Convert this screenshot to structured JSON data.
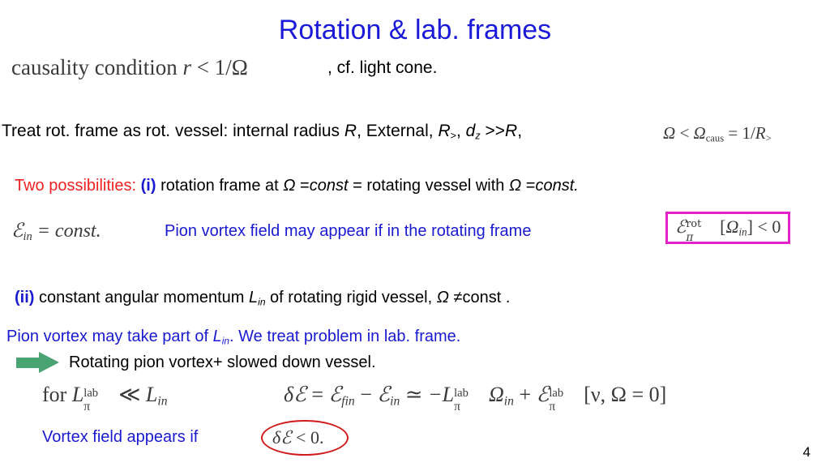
{
  "slide": {
    "title": "Rotation  & lab. frames",
    "page_number": "4",
    "colors": {
      "title_blue": "#1a1ad8",
      "accent_red": "#ee2222",
      "accent_blue": "#1a1ad0",
      "box_magenta": "#e222c8",
      "arrow_green": "#4aa373",
      "circle_red": "#d11a1a",
      "math_gray": "#3a3a3a"
    }
  },
  "causality": {
    "math_label": "causality condition",
    "math_variable": "r",
    "math_relation": "<",
    "math_bound_numerator": "1/",
    "math_bound_symbol": "Ω",
    "full_math": "causality condition  r < 1/Ω",
    "note": ", cf. light cone."
  },
  "treat_line": {
    "text_a": "Treat rot. frame as rot. vessel: internal  radius  ",
    "var_R": "R",
    "text_b": ", External, ",
    "var_Rgt": "R",
    "var_Rgt_sub": ">",
    "text_c": ", ",
    "var_d": "d",
    "var_d_sub": "z",
    "text_d": " >>",
    "var_R2": "R",
    "text_e": ",",
    "math": "Ω < Ω_caus = 1/R_>",
    "math_omega": "Ω",
    "math_less": "<",
    "math_omega2": "Ω",
    "math_omega2_sub": "caus",
    "math_equals": "= 1/",
    "math_R": "R",
    "math_R_sub": ">"
  },
  "two_possibilities": {
    "lead": "Two possibilities:",
    "marker": "(i)",
    "text_a": " rotation frame at ",
    "omega": "Ω",
    "text_b": " =",
    "const1": "const",
    "text_c": " = rotating vessel with ",
    "omega2": "Ω",
    "text_d": " =",
    "const2": "const."
  },
  "energy_in": {
    "math": "ℰ_in = const.",
    "math_script_E": "ℰ",
    "math_sub": "in",
    "math_rest": "= const.",
    "note": "Pion vortex field may appear if in the rotating frame"
  },
  "boxed_formula": {
    "script_E": "ℰ",
    "sup": "rot",
    "sub": "π",
    "bracket_open": "[",
    "omega": "Ω",
    "omega_sub": "in",
    "bracket_close": "]",
    "relation": "< 0",
    "full": "ℰ_π^rot[Ω_in] < 0"
  },
  "second_possibility": {
    "marker": "(ii)",
    "text_a": " constant angular momentum ",
    "var_L": "L",
    "var_L_sub": "in",
    "text_b": "  of rotating rigid vessel, ",
    "omega": "Ω",
    "text_c": " ≠const ."
  },
  "lab_frame": {
    "text_a": "Pion vortex may take part of ",
    "var_L": "L",
    "var_L_sub": "in",
    "text_b": ". We  treat problem in lab. frame."
  },
  "arrow_line": {
    "icon": "right-arrow-green",
    "text": "Rotating pion vortex+ slowed down vessel."
  },
  "bottom_math": {
    "for_text": "for",
    "for_L": "L",
    "for_L_sup": "lab",
    "for_L_sub": "π",
    "for_rel": "≪",
    "for_L2": "L",
    "for_L2_sub": "in",
    "for_full": "for L_π^lab ≪ L_in",
    "delta_E": "δℰ",
    "eq": "=",
    "E_fin": "ℰ",
    "E_fin_sub": "fin",
    "minus": "−",
    "E_in": "ℰ",
    "E_in_sub": "in",
    "approx": "≃",
    "neg_L": "−L",
    "neg_L_sup": "lab",
    "neg_L_sub": "π",
    "omega_in": "Ω",
    "omega_in_sub": "in",
    "plus": "+",
    "E_pi": "ℰ",
    "E_pi_sup": "lab",
    "E_pi_sub": "π",
    "bracket": "[ν, Ω = 0]",
    "delta_full": "δℰ = ℰ_fin − ℰ_in ≃ −L_π^lab Ω_in + ℰ_π^lab[ν, Ω = 0]"
  },
  "vortex_appears": {
    "text": "Vortex field appears if",
    "circled_delta": "δℰ",
    "circled_rel": "< 0.",
    "circled_full": "δℰ < 0."
  }
}
